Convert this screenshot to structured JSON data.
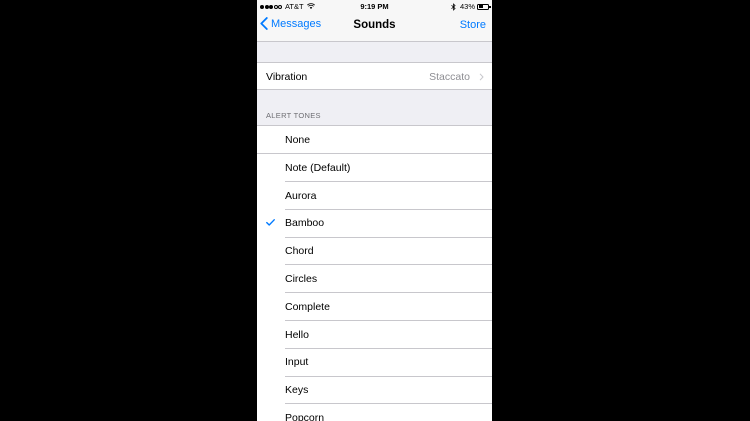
{
  "status_bar": {
    "carrier": "AT&T",
    "time": "9:19 PM",
    "battery": "43%",
    "battery_level": 0.43,
    "signal_bars": 3
  },
  "nav": {
    "back_label": "Messages",
    "title": "Sounds",
    "right_label": "Store"
  },
  "vibration": {
    "label": "Vibration",
    "value": "Staccato"
  },
  "alert_tones": {
    "header": "ALERT TONES",
    "selected": "Bamboo",
    "items": [
      {
        "label": "None",
        "checked": false
      },
      {
        "label": "Note (Default)",
        "checked": false
      },
      {
        "label": "Aurora",
        "checked": false
      },
      {
        "label": "Bamboo",
        "checked": true
      },
      {
        "label": "Chord",
        "checked": false
      },
      {
        "label": "Circles",
        "checked": false
      },
      {
        "label": "Complete",
        "checked": false
      },
      {
        "label": "Hello",
        "checked": false
      },
      {
        "label": "Input",
        "checked": false
      },
      {
        "label": "Keys",
        "checked": false
      },
      {
        "label": "Popcorn",
        "checked": false
      }
    ]
  },
  "colors": {
    "accent": "#007aff",
    "background": "#efeff4",
    "separator": "#c8c7cc"
  }
}
